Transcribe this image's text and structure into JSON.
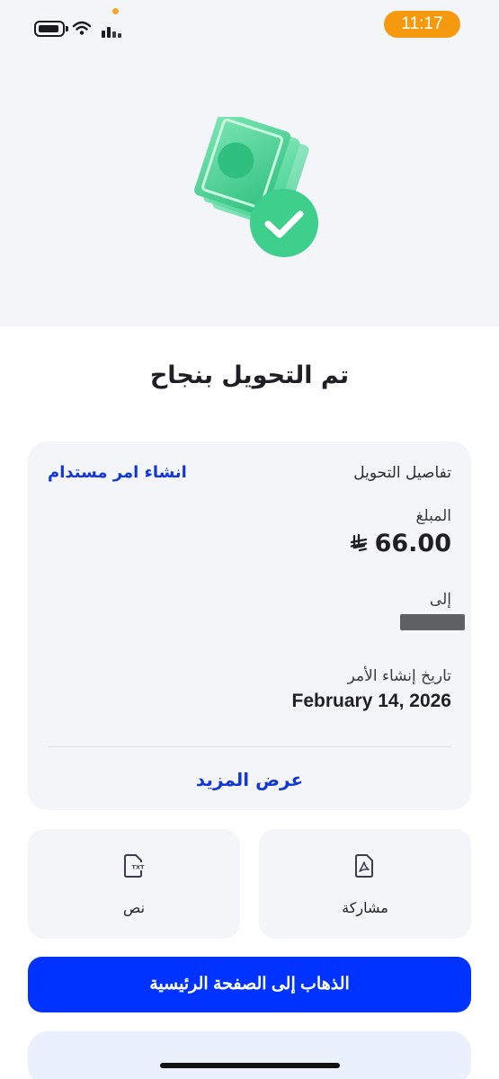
{
  "status_bar": {
    "time": "11:17",
    "icons": [
      "battery-icon",
      "wifi-icon",
      "signal-icon"
    ],
    "time_pill_color": "#f59a0e"
  },
  "hero": {
    "illustration": "money-success-icon",
    "accent": "#4dd39a"
  },
  "title": "تم التحويل بنجاح",
  "details": {
    "heading": "تفاصيل التحويل",
    "recurring_link": "انشاء امر مستدام",
    "amount_label": "المبلغ",
    "amount_value": "66.00",
    "currency_symbol": "⃁",
    "to_label": "إلى",
    "date_label": "تاريخ إنشاء الأمر",
    "date_value": "February 14, 2026",
    "show_more": "عرض المزيد"
  },
  "actions": {
    "share_label": "مشاركة",
    "share_icon": "pdf-file-icon",
    "text_label": "نص",
    "text_icon": "txt-file-icon"
  },
  "primary_button": "الذهاب إلى الصفحة الرئيسية",
  "colors": {
    "primary": "#0033ff",
    "link": "#1237d8"
  }
}
